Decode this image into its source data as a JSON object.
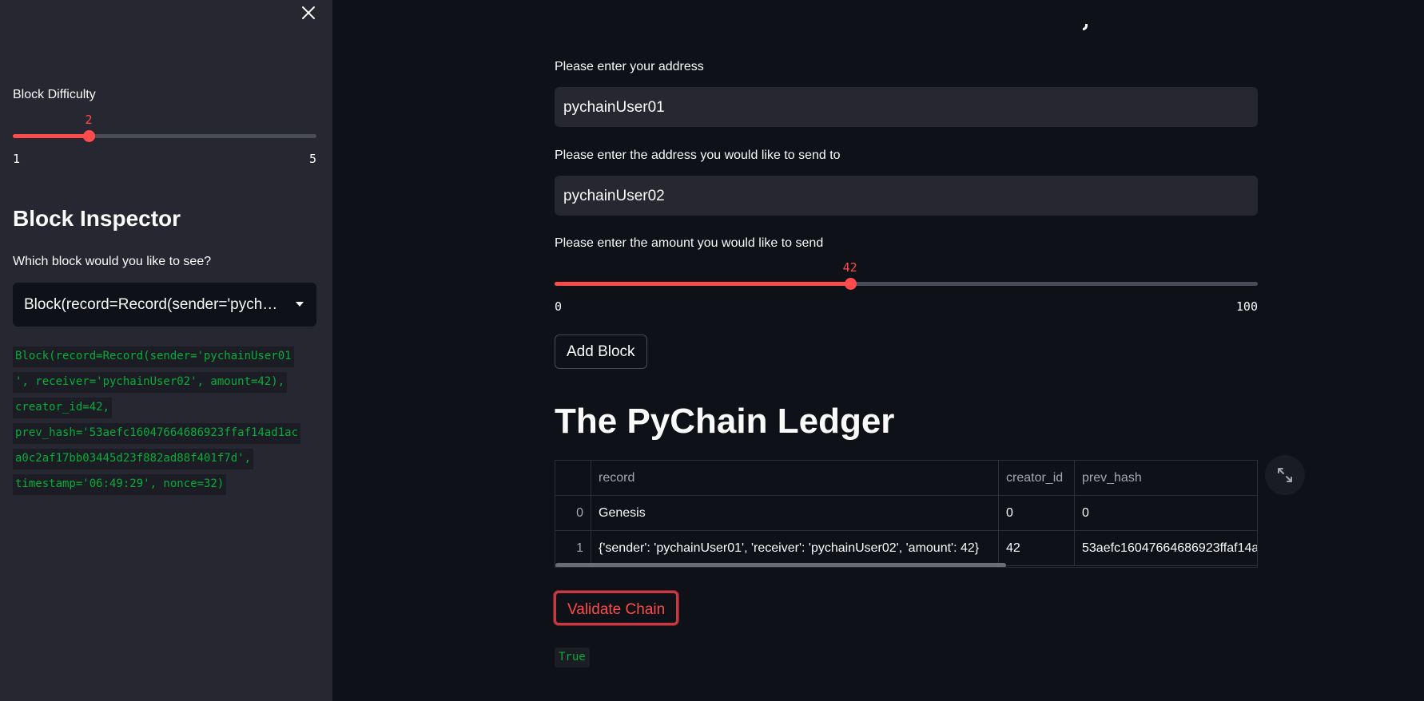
{
  "sidebar": {
    "close_icon": "close-icon",
    "difficulty": {
      "label": "Block Difficulty",
      "value": 2,
      "value_text": "2",
      "min": 1,
      "max": 5,
      "min_text": "1",
      "max_text": "5"
    },
    "inspector": {
      "heading": "Block Inspector",
      "select_label": "Which block would you like to see?",
      "selected_value": "Block(record=Record(sender='pychainUser01', receiver='pychainUser02', amount=42), creator_id=42, prev_hash='53aefc16047664686923ffaf14ad1aca0c2af17bb03445d23f882ad88f401f7d', timestamp='06:49:29', nonce=32)",
      "caret_icon": "chevron-down-icon",
      "code_lines": [
        "Block(record=Record(sender='pychainUser01",
        "', receiver='pychainUser02', amount=42),",
        "creator_id=42,",
        "prev_hash='53aefc16047664686923ffaf14ad1ac",
        "a0c2af17bb03445d23f882ad88f401f7d',",
        "timestamp='06:49:29', nonce=32)"
      ]
    }
  },
  "main": {
    "sender": {
      "label": "Please enter your address",
      "value": "pychainUser01"
    },
    "receiver": {
      "label": "Please enter the address you would like to send to",
      "value": "pychainUser02"
    },
    "amount": {
      "label": "Please enter the amount you would like to send",
      "value": 42,
      "value_text": "42",
      "min": 0,
      "max": 100,
      "min_text": "0",
      "max_text": "100"
    },
    "add_block_label": "Add Block",
    "ledger_heading": "The PyChain Ledger",
    "ledger": {
      "columns": [
        "",
        "record",
        "creator_id",
        "prev_hash"
      ],
      "rows": [
        [
          "0",
          "Genesis",
          "0",
          "0"
        ],
        [
          "1",
          "{'sender': 'pychainUser01', 'receiver': 'pychainUser02', 'amount': 42}",
          "42",
          "53aefc16047664686923ffaf14a"
        ]
      ]
    },
    "expand_icon": "expand-icon",
    "validate_label": "Validate Chain",
    "validate_result": "True"
  },
  "colors": {
    "accent": "#ff4b4b",
    "background": "#0e1117",
    "sidebar_background": "#262730",
    "code_green": "#09ab3b"
  }
}
